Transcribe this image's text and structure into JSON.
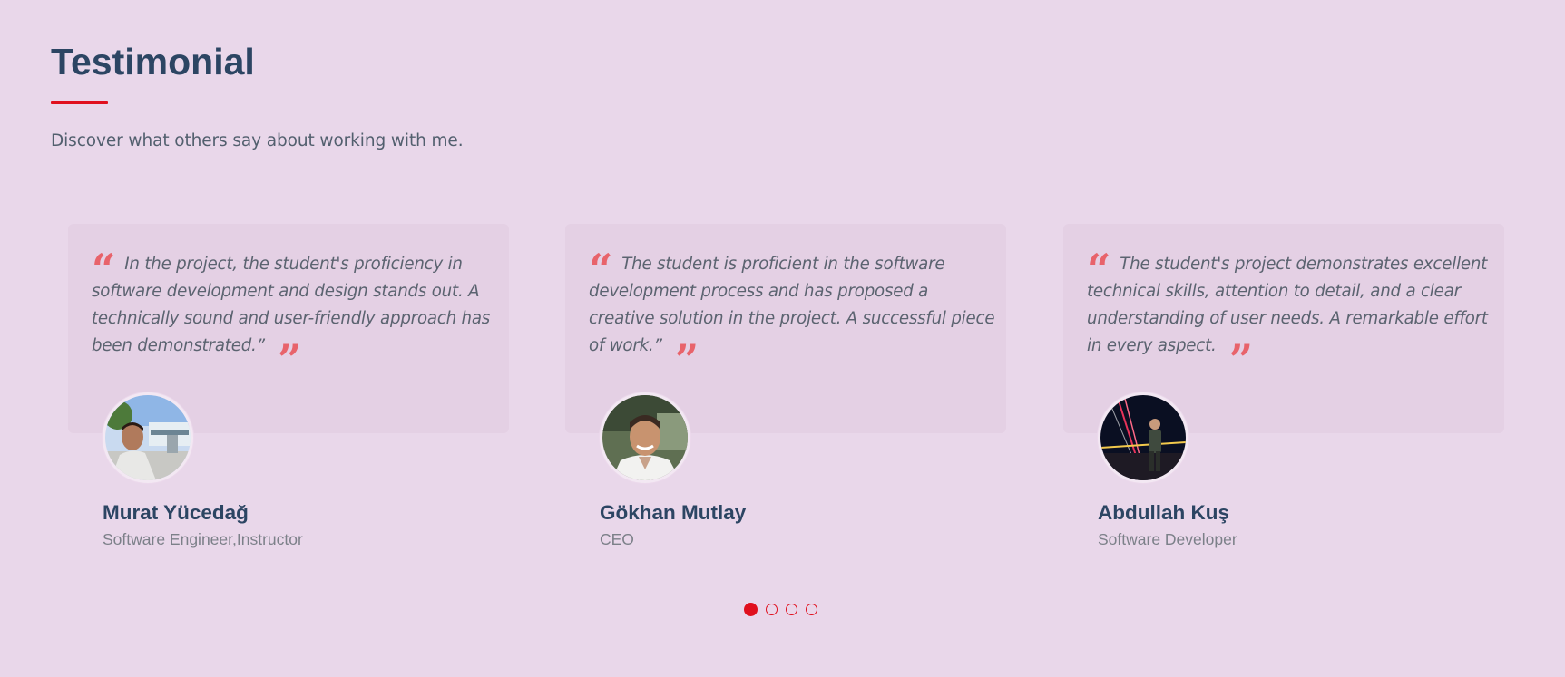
{
  "section": {
    "title": "Testimonial",
    "subtitle": "Discover what others say about working with me."
  },
  "testimonials": [
    {
      "quote": "In the project, the student's proficiency in software development and design stands out. A technically sound and user-friendly approach has been demonstrated.”",
      "name": "Murat Yücedağ",
      "role": "Software Engineer,Instructor"
    },
    {
      "quote": "The student is proficient in the software development process and has proposed a creative solution in the project. A successful piece of work.”",
      "name": "Gökhan Mutlay",
      "role": "CEO"
    },
    {
      "quote": "The student's project demonstrates excellent technical skills, attention to detail, and a clear understanding of user needs. A remarkable effort in every aspect.",
      "name": "Abdullah Kuş",
      "role": "Software Developer"
    }
  ],
  "pagination": {
    "total": 4,
    "active": 1
  },
  "colors": {
    "accent": "#e0101e",
    "quote_mark": "#e8636b",
    "heading": "#2c4563",
    "background": "#e9d7ea",
    "card": "#e4d0e4"
  },
  "icons": {
    "open_quote": "quote-open-icon",
    "close_quote": "quote-close-icon"
  }
}
